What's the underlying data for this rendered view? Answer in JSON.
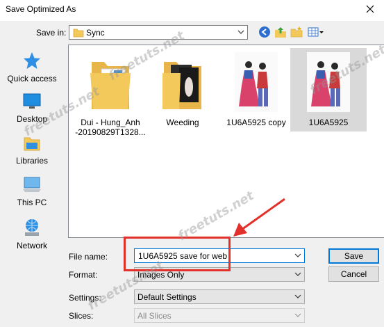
{
  "window": {
    "title": "Save Optimized As"
  },
  "save_in": {
    "label": "Save in:",
    "folder": "Sync"
  },
  "places": [
    {
      "label": "Quick access",
      "icon": "star-icon"
    },
    {
      "label": "Desktop",
      "icon": "desktop-icon"
    },
    {
      "label": "Libraries",
      "icon": "libraries-icon"
    },
    {
      "label": "This PC",
      "icon": "computer-icon"
    },
    {
      "label": "Network",
      "icon": "network-icon"
    }
  ],
  "files": [
    {
      "name": "Dui - Hung_Anh\n-20190829T1328...",
      "type": "folder"
    },
    {
      "name": "Weeding",
      "type": "folder"
    },
    {
      "name": "1U6A5925 copy",
      "type": "image"
    },
    {
      "name": "1U6A5925",
      "type": "image",
      "selected": true
    }
  ],
  "form": {
    "file_name_label": "File name:",
    "file_name_value": "1U6A5925 save for web",
    "format_label": "Format:",
    "format_value": "Images Only",
    "settings_label": "Settings:",
    "settings_value": "Default Settings",
    "slices_label": "Slices:",
    "slices_value": "All Slices"
  },
  "buttons": {
    "save": "Save",
    "cancel": "Cancel"
  },
  "watermark": "freetuts.net",
  "colors": {
    "accent": "#0078d7",
    "annotation": "#e2302a",
    "folder": "#f4c95c"
  }
}
